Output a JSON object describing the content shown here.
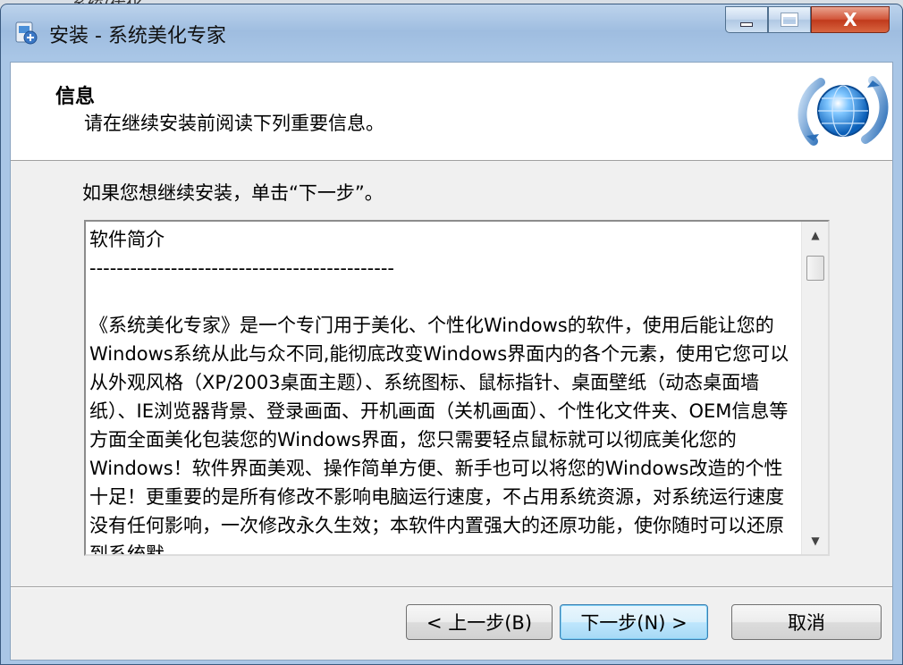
{
  "window": {
    "title": "安装 - 系统美化专家",
    "behind_text": "系统(优化"
  },
  "caption": {
    "close_label": "X"
  },
  "header": {
    "title": "信息",
    "subtitle": "请在继续安装前阅读下列重要信息。"
  },
  "intro": "如果您想继续安装，单击“下一步”。",
  "memo": {
    "text": "软件简介\n---------------------------------------------\n\n《系统美化专家》是一个专门用于美化、个性化Windows的软件，使用后能让您的Windows系统从此与众不同,能彻底改变Windows界面内的各个元素，使用它您可以从外观风格（XP/2003桌面主题）、系统图标、鼠标指针、桌面壁纸（动态桌面墙纸）、IE浏览器背景、登录画面、开机画面（关机画面）、个性化文件夹、OEM信息等方面全面美化包装您的Windows界面，您只需要轻点鼠标就可以彻底美化您的Windows！软件界面美观、操作简单方便、新手也可以将您的Windows改造的个性十足！更重要的是所有修改不影响电脑运行速度，不占用系统资源，对系统运行速度没有任何影响，一次修改永久生效；本软件内置强大的还原功能，使你随时可以还原到系统默"
  },
  "buttons": {
    "back": "< 上一步(B)",
    "next": "下一步(N) >",
    "cancel": "取消"
  },
  "colors": {
    "accent": "#3c7fb1",
    "close": "#c03a1c"
  }
}
